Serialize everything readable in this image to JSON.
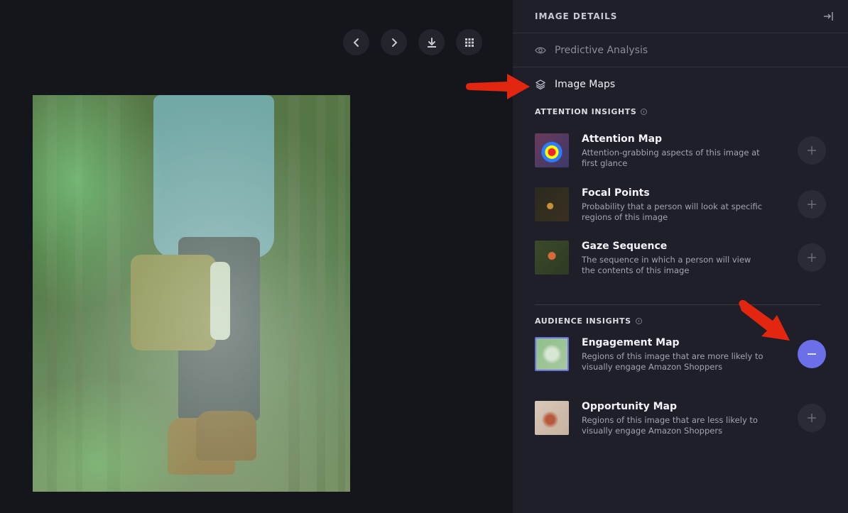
{
  "panel": {
    "title": "IMAGE DETAILS",
    "predictive_label": "Predictive Analysis",
    "maps_label": "Image Maps"
  },
  "attention": {
    "heading": "ATTENTION INSIGHTS",
    "items": [
      {
        "title": "Attention Map",
        "desc": "Attention-grabbing aspects of this image at first glance"
      },
      {
        "title": "Focal Points",
        "desc": "Probability that a person will look at specific regions of this image"
      },
      {
        "title": "Gaze Sequence",
        "desc": "The sequence in which a person will view the contents of this image"
      }
    ]
  },
  "audience": {
    "heading": "AUDIENCE INSIGHTS",
    "items": [
      {
        "title": "Engagement Map",
        "desc": "Regions of this image that are more likely to visually engage Amazon Shoppers",
        "active": true
      },
      {
        "title": "Opportunity Map",
        "desc": "Regions of this image that are less likely to visually engage Amazon Shoppers",
        "active": false
      }
    ]
  },
  "colors": {
    "accent": "#6b70e8",
    "annotation_arrow": "#e2260f",
    "panel_bg": "#1f1f29",
    "viewer_bg": "#15151c"
  },
  "icons": {
    "toolbar": [
      "chevron-left-icon",
      "chevron-right-icon",
      "download-icon",
      "grid-icon"
    ],
    "panel_collapse": "collapse-right-icon",
    "predictive": "eye-icon",
    "maps": "layers-icon"
  }
}
